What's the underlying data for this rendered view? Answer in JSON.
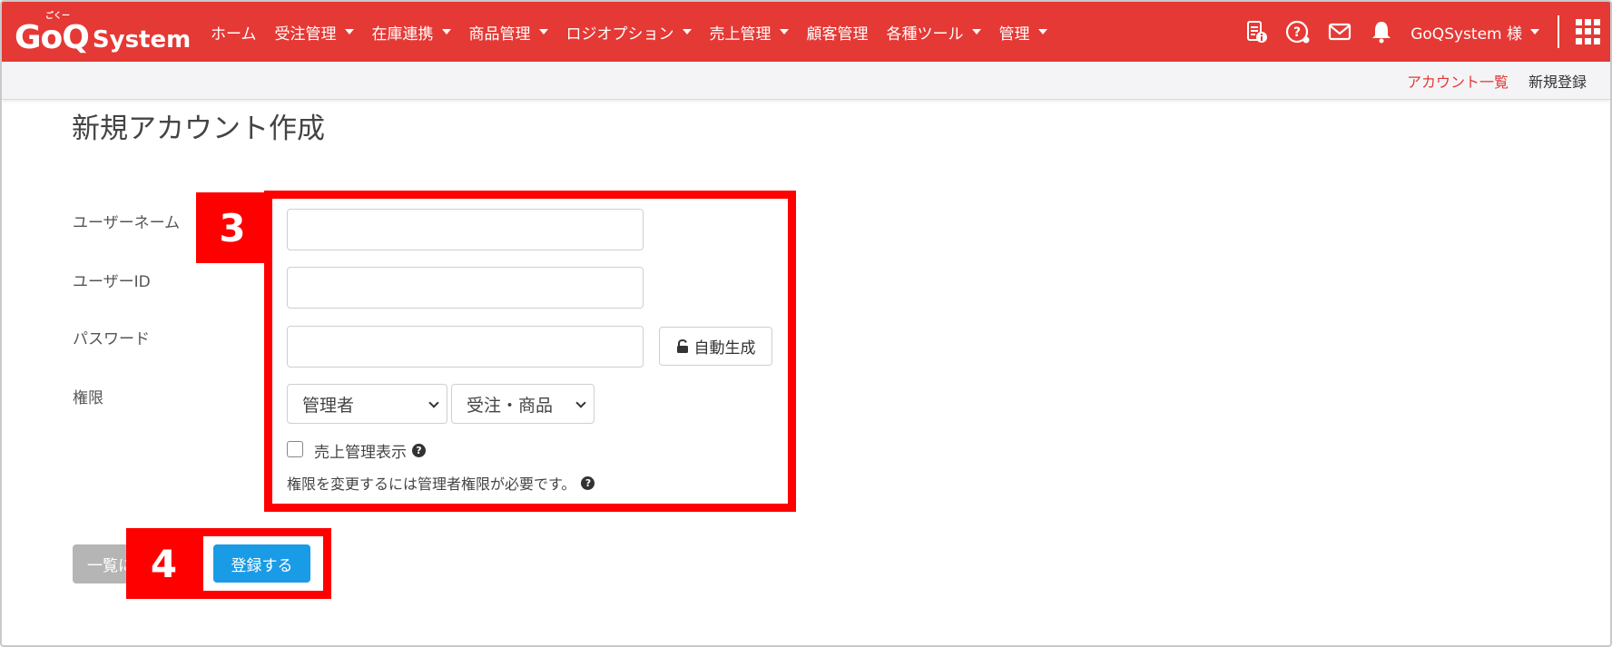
{
  "brand": {
    "logo_main": "GoQ",
    "logo_sub": "System",
    "logo_ruby": "ごくー"
  },
  "nav": {
    "items": [
      {
        "label": "ホーム",
        "dropdown": false
      },
      {
        "label": "受注管理",
        "dropdown": true
      },
      {
        "label": "在庫連携",
        "dropdown": true
      },
      {
        "label": "商品管理",
        "dropdown": true
      },
      {
        "label": "ロジオプション",
        "dropdown": true
      },
      {
        "label": "売上管理",
        "dropdown": true
      },
      {
        "label": "顧客管理",
        "dropdown": false
      },
      {
        "label": "各種ツール",
        "dropdown": true
      },
      {
        "label": "管理",
        "dropdown": true
      }
    ],
    "user_label": "GoQSystem 様",
    "icons": [
      "document-info-icon",
      "help-icon",
      "mail-icon",
      "bell-icon",
      "apps-grid-icon"
    ]
  },
  "subnav": {
    "account_list": "アカウント一覧",
    "new_register": "新規登録"
  },
  "page": {
    "title": "新規アカウント作成"
  },
  "form": {
    "username_label": "ユーザーネーム",
    "userid_label": "ユーザーID",
    "password_label": "パスワード",
    "permission_label": "権限",
    "username_value": "",
    "userid_value": "",
    "password_value": "",
    "auto_generate_label": "自動生成",
    "role_select": "管理者",
    "scope_select": "受注・商品",
    "sales_display_label": "売上管理表示",
    "sales_display_checked": false,
    "permission_note": "権限を変更するには管理者権限が必要です。"
  },
  "actions": {
    "back_label": "一覧に",
    "submit_label": "登録する"
  },
  "annotations": {
    "step3": "3",
    "step4": "4"
  },
  "colors": {
    "brand_red": "#e53935",
    "annotation_red": "#ff0000",
    "submit_blue": "#1a9be6",
    "back_gray": "#b5b5b5"
  }
}
